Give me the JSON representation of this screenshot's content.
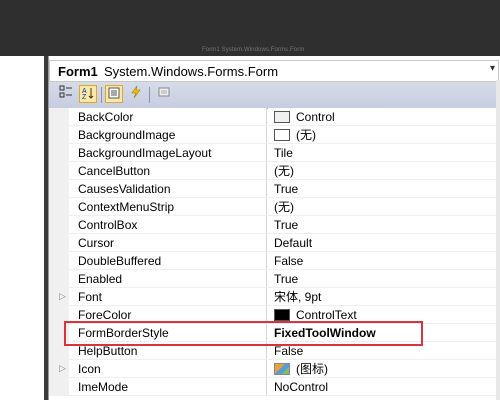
{
  "caption": "Form1 System.Windows.Forms.Form",
  "object_selector": {
    "name": "Form1",
    "type": "System.Windows.Forms.Form"
  },
  "toolbar": {
    "buttons": [
      {
        "icon": "categorized-icon",
        "active": false
      },
      {
        "icon": "alphabetical-icon",
        "active": true
      },
      {
        "icon": "properties-icon",
        "active": true
      },
      {
        "icon": "events-icon",
        "active": false
      },
      {
        "icon": "property-pages-icon",
        "active": false
      }
    ]
  },
  "properties": [
    {
      "name": "BackColor",
      "value": "Control",
      "swatch": "#f0f0f0"
    },
    {
      "name": "BackgroundImage",
      "value": "(无)",
      "swatch": "#ffffff"
    },
    {
      "name": "BackgroundImageLayout",
      "value": "Tile"
    },
    {
      "name": "CancelButton",
      "value": "(无)"
    },
    {
      "name": "CausesValidation",
      "value": "True"
    },
    {
      "name": "ContextMenuStrip",
      "value": "(无)"
    },
    {
      "name": "ControlBox",
      "value": "True"
    },
    {
      "name": "Cursor",
      "value": "Default"
    },
    {
      "name": "DoubleBuffered",
      "value": "False"
    },
    {
      "name": "Enabled",
      "value": "True"
    },
    {
      "name": "Font",
      "value": "宋体, 9pt",
      "expandable": true
    },
    {
      "name": "ForeColor",
      "value": "ControlText",
      "swatch": "#000000"
    },
    {
      "name": "FormBorderStyle",
      "value": "FixedToolWindow",
      "bold": true,
      "highlighted": true
    },
    {
      "name": "HelpButton",
      "value": "False"
    },
    {
      "name": "Icon",
      "value": "(图标)",
      "expandable": true,
      "icon_swatch": true
    },
    {
      "name": "ImeMode",
      "value": "NoControl"
    }
  ],
  "highlight_color": "#d9343b"
}
